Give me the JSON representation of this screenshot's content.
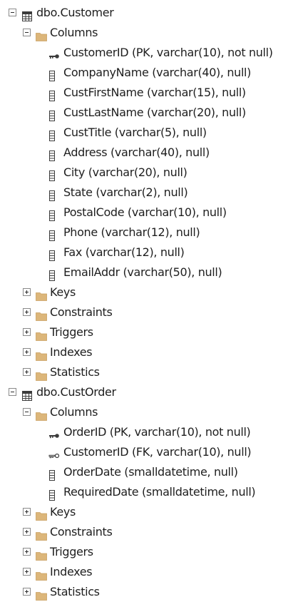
{
  "tree": [
    {
      "label": "dbo.Customer",
      "icon": "table-icon",
      "expanded": true,
      "children": [
        {
          "label": "Columns",
          "icon": "folder-icon",
          "expanded": true,
          "columns": [
            {
              "label": "CustomerID (PK, varchar(10), not null)",
              "icon": "primary-key-icon"
            },
            {
              "label": "CompanyName (varchar(40), null)",
              "icon": "column-icon"
            },
            {
              "label": "CustFirstName (varchar(15), null)",
              "icon": "column-icon"
            },
            {
              "label": "CustLastName (varchar(20), null)",
              "icon": "column-icon"
            },
            {
              "label": "CustTitle (varchar(5), null)",
              "icon": "column-icon"
            },
            {
              "label": "Address (varchar(40), null)",
              "icon": "column-icon"
            },
            {
              "label": "City (varchar(20), null)",
              "icon": "column-icon"
            },
            {
              "label": "State (varchar(2), null)",
              "icon": "column-icon"
            },
            {
              "label": "PostalCode (varchar(10), null)",
              "icon": "column-icon"
            },
            {
              "label": "Phone (varchar(12), null)",
              "icon": "column-icon"
            },
            {
              "label": "Fax (varchar(12), null)",
              "icon": "column-icon"
            },
            {
              "label": "EmailAddr (varchar(50), null)",
              "icon": "column-icon"
            }
          ]
        },
        {
          "label": "Keys",
          "icon": "folder-icon",
          "expanded": false
        },
        {
          "label": "Constraints",
          "icon": "folder-icon",
          "expanded": false
        },
        {
          "label": "Triggers",
          "icon": "folder-icon",
          "expanded": false
        },
        {
          "label": "Indexes",
          "icon": "folder-icon",
          "expanded": false
        },
        {
          "label": "Statistics",
          "icon": "folder-icon",
          "expanded": false
        }
      ]
    },
    {
      "label": "dbo.CustOrder",
      "icon": "table-icon",
      "expanded": true,
      "children": [
        {
          "label": "Columns",
          "icon": "folder-icon",
          "expanded": true,
          "columns": [
            {
              "label": "OrderID (PK, varchar(10), not null)",
              "icon": "primary-key-icon"
            },
            {
              "label": "CustomerID (FK, varchar(10), null)",
              "icon": "foreign-key-icon"
            },
            {
              "label": "OrderDate (smalldatetime, null)",
              "icon": "column-icon"
            },
            {
              "label": "RequiredDate (smalldatetime, null)",
              "icon": "column-icon"
            }
          ]
        },
        {
          "label": "Keys",
          "icon": "folder-icon",
          "expanded": false
        },
        {
          "label": "Constraints",
          "icon": "folder-icon",
          "expanded": false
        },
        {
          "label": "Triggers",
          "icon": "folder-icon",
          "expanded": false
        },
        {
          "label": "Indexes",
          "icon": "folder-icon",
          "expanded": false
        },
        {
          "label": "Statistics",
          "icon": "folder-icon",
          "expanded": false
        }
      ]
    }
  ],
  "colors": {
    "folder": "#dcb67a",
    "expander_border": "#8a8a8a",
    "icon_dark": "#3c3c3c",
    "text": "#1e1e1e"
  }
}
